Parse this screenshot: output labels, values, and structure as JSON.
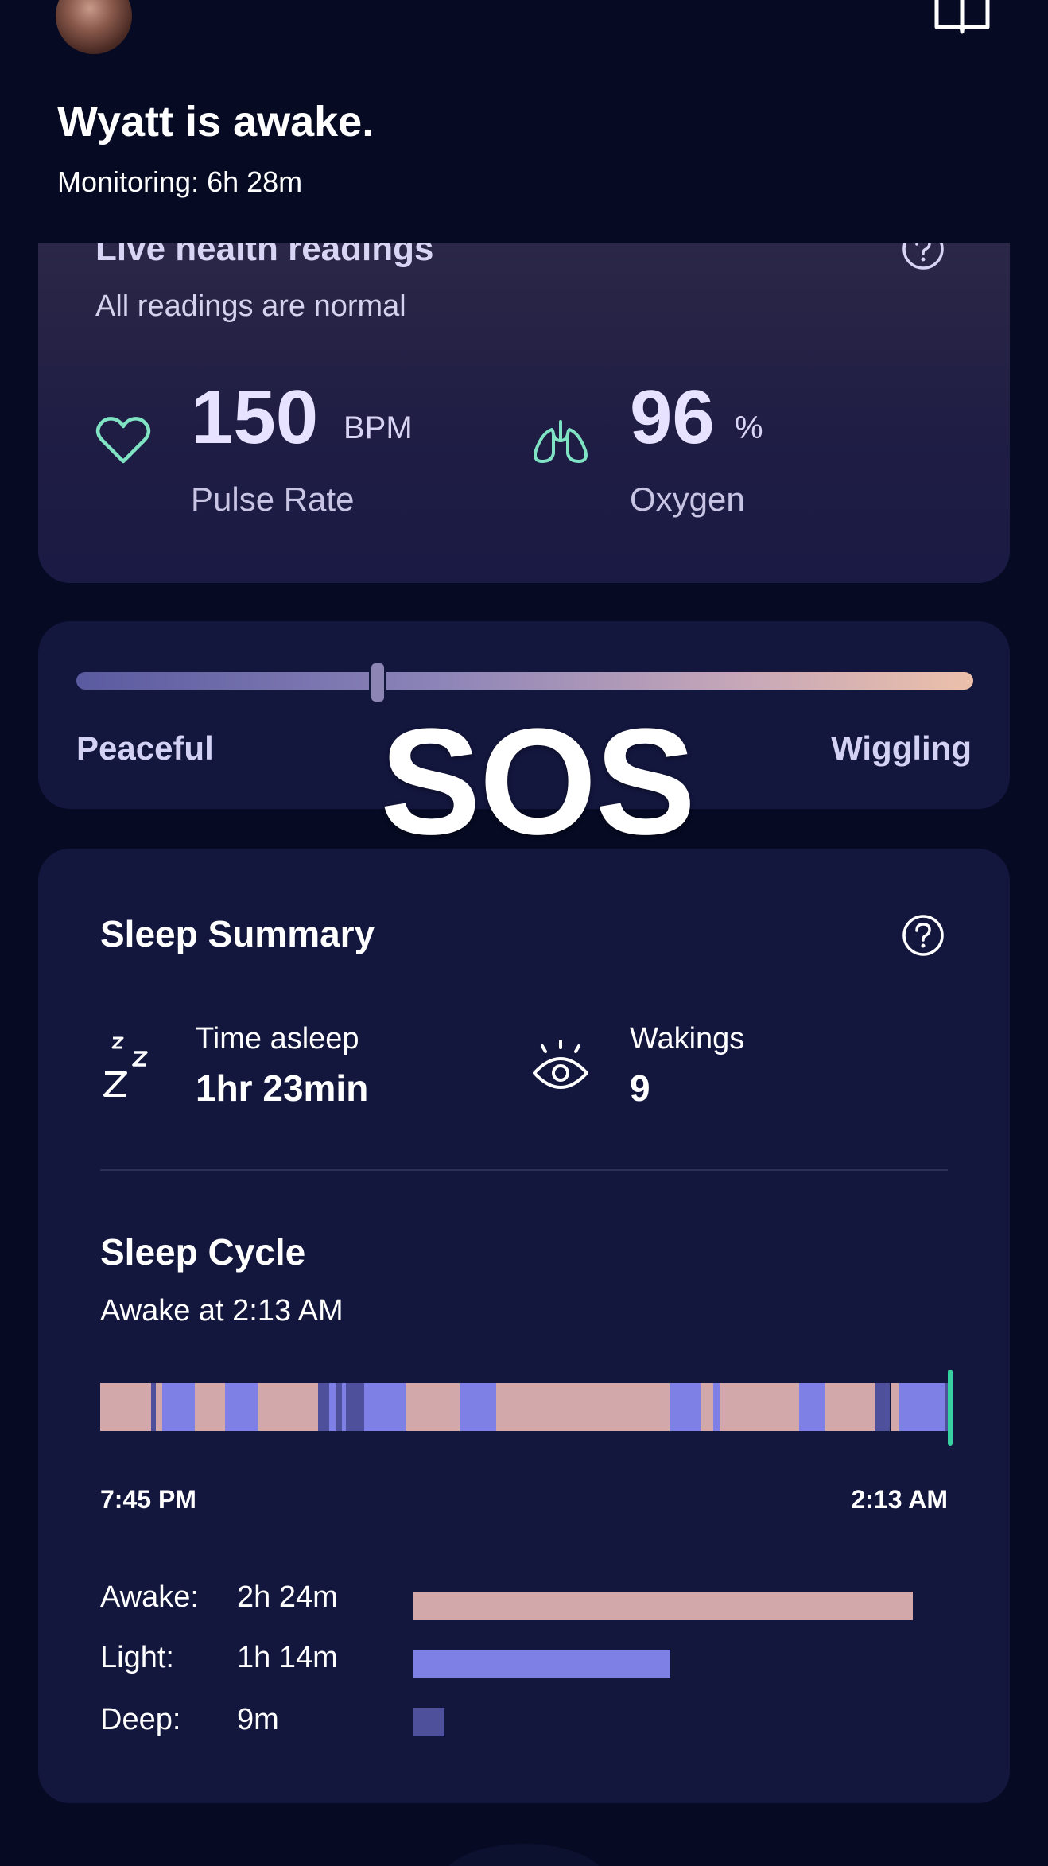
{
  "header": {
    "title": "Wyatt is awake.",
    "monitoring": "Monitoring: 6h 28m",
    "avatar_icon": "avatar",
    "book_icon": "book-icon"
  },
  "health": {
    "title": "Live health readings",
    "status": "All readings are normal",
    "pulse": {
      "value": "150",
      "unit": "BPM",
      "label": "Pulse Rate",
      "icon": "heart-icon",
      "icon_color": "#7fe3c4"
    },
    "oxygen": {
      "value": "96",
      "unit": "%",
      "label": "Oxygen",
      "icon": "lungs-icon",
      "icon_color": "#7fe3c4"
    }
  },
  "mood": {
    "left_label": "Peaceful",
    "right_label": "Wiggling",
    "level": 0.33
  },
  "overlay": {
    "sos": "SOS"
  },
  "sleep_summary": {
    "title": "Sleep Summary",
    "time_asleep_label": "Time asleep",
    "time_asleep_value": "1hr 23min",
    "wakings_label": "Wakings",
    "wakings_value": "9"
  },
  "sleep_cycle": {
    "title": "Sleep Cycle",
    "subtitle": "Awake at 2:13 AM",
    "start_time": "7:45 PM",
    "end_time": "2:13 AM",
    "colors": {
      "awake": "#d2a8aa",
      "light": "#7e80e6",
      "deep": "#4e509c",
      "now": "#39d0a0"
    },
    "stages": [
      {
        "name": "Awake:",
        "duration": "2h 24m",
        "key": "awake",
        "fraction": 1.0
      },
      {
        "name": "Light:",
        "duration": "1h 14m",
        "key": "light",
        "fraction": 0.514
      },
      {
        "name": "Deep:",
        "duration": "9m",
        "key": "deep",
        "fraction": 0.0625
      }
    ],
    "timeline": [
      [
        "awake",
        0.0,
        0.06
      ],
      [
        "deep",
        0.06,
        0.066
      ],
      [
        "awake",
        0.066,
        0.073
      ],
      [
        "light",
        0.073,
        0.112
      ],
      [
        "awake",
        0.112,
        0.147
      ],
      [
        "light",
        0.147,
        0.186
      ],
      [
        "awake",
        0.186,
        0.257
      ],
      [
        "deep",
        0.257,
        0.27
      ],
      [
        "light",
        0.27,
        0.278
      ],
      [
        "deep",
        0.278,
        0.285
      ],
      [
        "light",
        0.285,
        0.29
      ],
      [
        "deep",
        0.29,
        0.311
      ],
      [
        "light",
        0.311,
        0.36
      ],
      [
        "awake",
        0.36,
        0.424
      ],
      [
        "light",
        0.424,
        0.467
      ],
      [
        "awake",
        0.467,
        0.672
      ],
      [
        "light",
        0.672,
        0.708
      ],
      [
        "awake",
        0.708,
        0.723
      ],
      [
        "light",
        0.723,
        0.731
      ],
      [
        "awake",
        0.731,
        0.825
      ],
      [
        "light",
        0.825,
        0.855
      ],
      [
        "awake",
        0.855,
        0.915
      ],
      [
        "deep",
        0.915,
        0.932
      ],
      [
        "awake",
        0.932,
        0.942
      ],
      [
        "light",
        0.942,
        0.996
      ],
      [
        "deep",
        0.996,
        1.0
      ]
    ]
  }
}
